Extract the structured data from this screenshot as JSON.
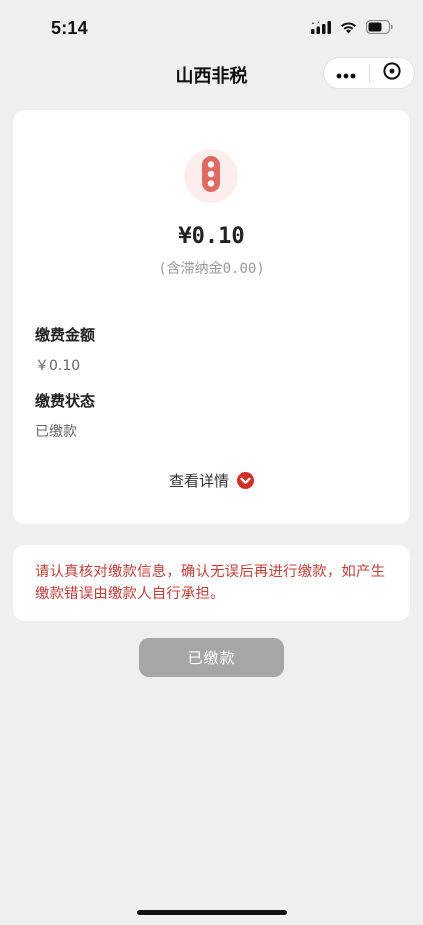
{
  "status_bar": {
    "time": "5:14"
  },
  "nav": {
    "title": "山西非税"
  },
  "payment": {
    "amount": "¥0.10",
    "late_fee_note": "(含滞纳金0.00)",
    "fields": [
      {
        "label": "缴费金额",
        "value": "￥0.10"
      },
      {
        "label": "缴费状态",
        "value": "已缴款"
      }
    ],
    "detail_toggle_label": "查看详情"
  },
  "notice": {
    "text": "请认真核对缴款信息，确认无误后再进行缴款，如产生缴款错误由缴款人自行承担。"
  },
  "action": {
    "paid_button_label": "已缴款"
  },
  "colors": {
    "accent_red": "#d0302a",
    "notice_red": "#c0413b",
    "logo_bg": "#fdeeee",
    "logo_fg": "#e06a60",
    "disabled_button": "#a6a6a6"
  },
  "icons": {
    "signal": "cellular-signal-icon",
    "wifi": "wifi-icon",
    "battery": "battery-icon",
    "more": "more-dots-icon",
    "close": "close-circle-icon",
    "logo": "traffic-light-logo-icon",
    "chevron": "chevron-down-icon"
  }
}
